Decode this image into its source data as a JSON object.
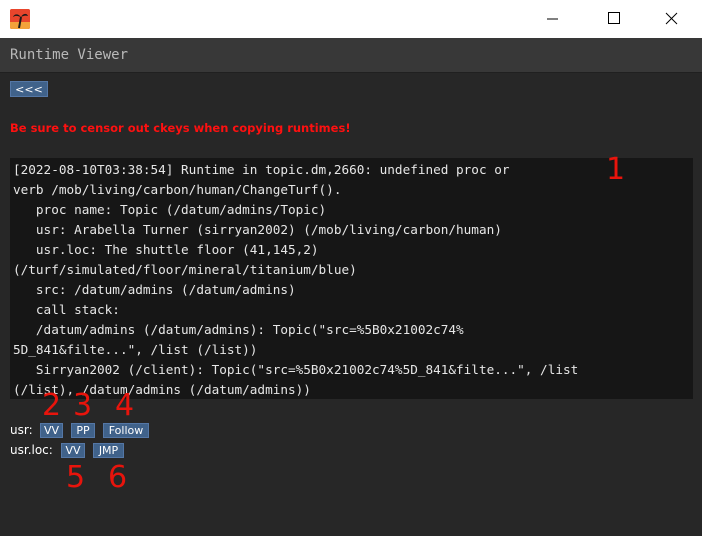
{
  "window": {
    "title": "",
    "controls": [
      "minimize",
      "maximize",
      "close"
    ]
  },
  "header": {
    "title": "Runtime Viewer"
  },
  "toolbar": {
    "back_label": "<<<"
  },
  "warning": {
    "text": "Be sure to censor out ckeys when copying runtimes!"
  },
  "log": {
    "lines": [
      "[2022-08-10T03:38:54] Runtime in topic.dm,2660: undefined proc or",
      "verb /mob/living/carbon/human/ChangeTurf().",
      "   proc name: Topic (/datum/admins/Topic)",
      "   usr: Arabella Turner (sirryan2002) (/mob/living/carbon/human)",
      "   usr.loc: The shuttle floor (41,145,2)",
      "(/turf/simulated/floor/mineral/titanium/blue)",
      "   src: /datum/admins (/datum/admins)",
      "   call stack:",
      "   /datum/admins (/datum/admins): Topic(\"src=%5B0x21002c74%",
      "5D_841&filte...\", /list (/list))",
      "   Sirryan2002 (/client): Topic(\"src=%5B0x21002c74%5D_841&filte...\", /list",
      "(/list), /datum/admins (/datum/admins))"
    ]
  },
  "actions": {
    "usr_label": "usr:",
    "usr_vv": "VV",
    "usr_pp": "PP",
    "usr_follow": "Follow",
    "loc_label": "usr.loc:",
    "loc_vv": "VV",
    "loc_jmp": "JMP"
  },
  "annotations": {
    "n1": "1",
    "n2": "2",
    "n3": "3",
    "n4": "4",
    "n5": "5",
    "n6": "6"
  },
  "colors": {
    "background": "#272727",
    "log_background": "#161616",
    "button": "#40628a",
    "warning": "#ff1010",
    "annotation": "#e8140c"
  }
}
